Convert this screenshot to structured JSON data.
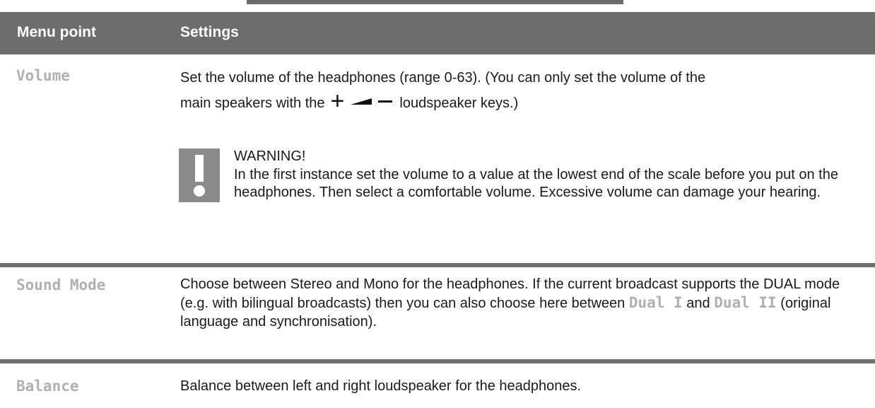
{
  "table": {
    "headers": {
      "menu_point": "Menu point",
      "settings": "Settings"
    },
    "rows": [
      {
        "label": "Volume",
        "text_part1": "Set the volume of the headphones (range 0-63). (You can only set the volume of the",
        "text_part2_before": "main speakers with the",
        "text_part2_after": "loudspeaker keys.)",
        "speaker_keys": {
          "plus_icon": "plus-icon",
          "volume_icon": "volume-wedge-icon",
          "minus_icon": "minus-icon"
        },
        "warning": {
          "icon": "exclamation-icon",
          "title": "WARNING!",
          "text": "In the first instance set the volume to a value at the lowest end of the scale before you put on the headphones. Then select a comfortable volume. Excessive volume can damage your hearing."
        }
      },
      {
        "label": "Sound Mode",
        "text_a": "Choose between Stereo and Mono for the headphones. If the current broadcast supports the DUAL mode (e.g. with bilingual broadcasts) then you can also choose here between",
        "option_1": "Dual I",
        "text_b": "and",
        "option_2": "Dual II",
        "text_c": "(original language and synchronisation)."
      },
      {
        "label": "Balance",
        "text": "Balance between left and right loudspeaker for the headphones."
      }
    ]
  }
}
